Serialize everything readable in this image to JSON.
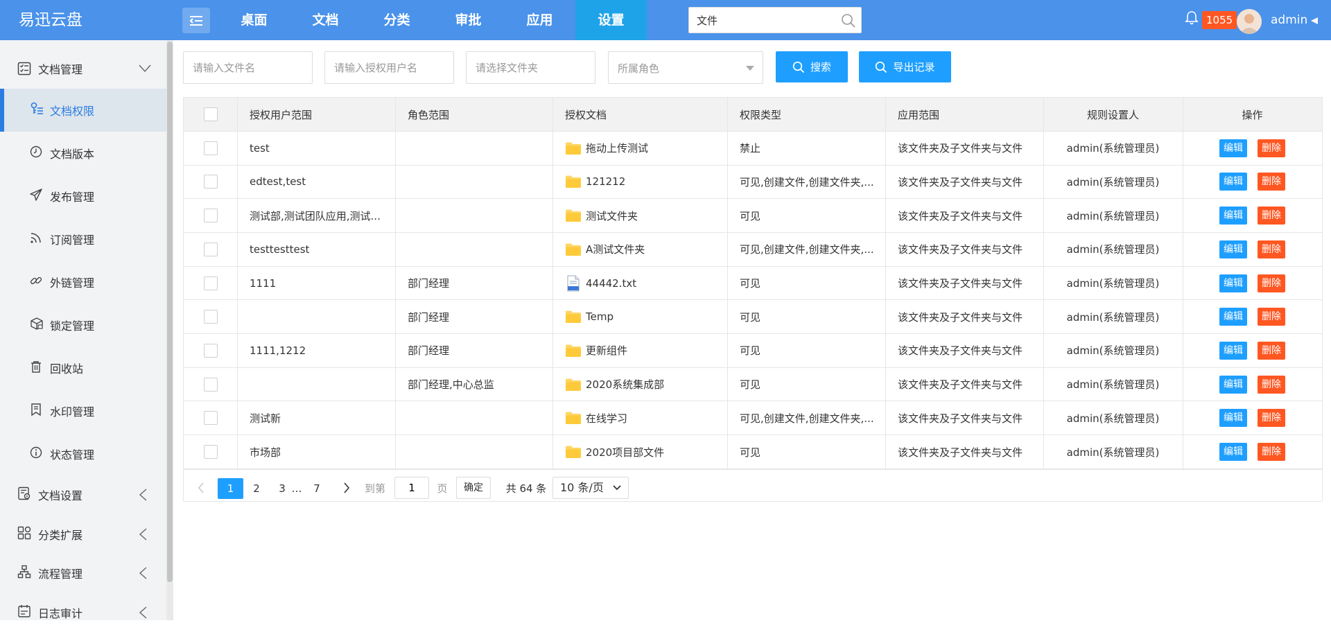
{
  "app": {
    "brand": "易迅云盘"
  },
  "nav": {
    "items": [
      "桌面",
      "文档",
      "分类",
      "审批",
      "应用",
      "设置"
    ],
    "active_index": 5
  },
  "top_search": {
    "value": "文件"
  },
  "user": {
    "notification_count": "1055",
    "name": "admin"
  },
  "sidebar": {
    "group_main": "文档管理",
    "items": [
      {
        "label": "文档权限",
        "icon": "key-user-icon"
      },
      {
        "label": "文档版本",
        "icon": "clock-icon"
      },
      {
        "label": "发布管理",
        "icon": "send-icon"
      },
      {
        "label": "订阅管理",
        "icon": "rss-icon"
      },
      {
        "label": "外链管理",
        "icon": "link-icon"
      },
      {
        "label": "锁定管理",
        "icon": "lock-box-icon"
      },
      {
        "label": "回收站",
        "icon": "trash-icon"
      },
      {
        "label": "水印管理",
        "icon": "watermark-icon"
      },
      {
        "label": "状态管理",
        "icon": "info-icon"
      }
    ],
    "active_item": 0,
    "groups": [
      {
        "label": "文档设置",
        "icon": "doc-settings-icon"
      },
      {
        "label": "分类扩展",
        "icon": "grid-icon"
      },
      {
        "label": "流程管理",
        "icon": "flow-icon"
      },
      {
        "label": "日志审计",
        "icon": "log-icon"
      }
    ]
  },
  "filters": {
    "filename_placeholder": "请输入文件名",
    "username_placeholder": "请输入授权用户名",
    "folder_placeholder": "请选择文件夹",
    "role_placeholder": "所属角色",
    "search_label": "搜索",
    "export_label": "导出记录"
  },
  "table": {
    "headers": [
      "授权用户范围",
      "角色范围",
      "授权文档",
      "权限类型",
      "应用范围",
      "规则设置人",
      "操作"
    ],
    "edit_label": "编辑",
    "delete_label": "删除",
    "rows": [
      {
        "users": "test",
        "roles": "",
        "doc": "拖动上传测试",
        "doc_type": "folder",
        "perm": "禁止",
        "scope": "该文件夹及子文件夹与文件",
        "setter": "admin(系统管理员)"
      },
      {
        "users": "edtest,test",
        "roles": "",
        "doc": "121212",
        "doc_type": "folder",
        "perm": "可见,创建文件,创建文件夹,...",
        "scope": "该文件夹及子文件夹与文件",
        "setter": "admin(系统管理员)"
      },
      {
        "users": "测试部,测试团队应用,测试...",
        "roles": "",
        "doc": "测试文件夹",
        "doc_type": "folder",
        "perm": "可见",
        "scope": "该文件夹及子文件夹与文件",
        "setter": "admin(系统管理员)"
      },
      {
        "users": "testtesttest",
        "roles": "",
        "doc": "A测试文件夹",
        "doc_type": "folder",
        "perm": "可见,创建文件,创建文件夹,...",
        "scope": "该文件夹及子文件夹与文件",
        "setter": "admin(系统管理员)"
      },
      {
        "users": "1111",
        "roles": "部门经理",
        "doc": "44442.txt",
        "doc_type": "txt",
        "perm": "可见",
        "scope": "该文件夹及子文件夹与文件",
        "setter": "admin(系统管理员)"
      },
      {
        "users": "",
        "roles": "部门经理",
        "doc": "Temp",
        "doc_type": "folder",
        "perm": "可见",
        "scope": "该文件夹及子文件夹与文件",
        "setter": "admin(系统管理员)"
      },
      {
        "users": "1111,1212",
        "roles": "部门经理",
        "doc": "更新组件",
        "doc_type": "folder",
        "perm": "可见",
        "scope": "该文件夹及子文件夹与文件",
        "setter": "admin(系统管理员)"
      },
      {
        "users": "",
        "roles": "部门经理,中心总监",
        "doc": "2020系统集成部",
        "doc_type": "folder",
        "perm": "可见",
        "scope": "该文件夹及子文件夹与文件",
        "setter": "admin(系统管理员)"
      },
      {
        "users": "测试新",
        "roles": "",
        "doc": "在线学习",
        "doc_type": "folder",
        "perm": "可见,创建文件,创建文件夹,...",
        "scope": "该文件夹及子文件夹与文件",
        "setter": "admin(系统管理员)"
      },
      {
        "users": "市场部",
        "roles": "",
        "doc": "2020项目部文件",
        "doc_type": "folder",
        "perm": "可见",
        "scope": "该文件夹及子文件夹与文件",
        "setter": "admin(系统管理员)"
      }
    ]
  },
  "pager": {
    "pages": [
      "1",
      "2",
      "3"
    ],
    "ellipsis": "…",
    "last_page": "7",
    "current": "1",
    "goto_prefix": "到第",
    "goto_value": "1",
    "goto_suffix": "页",
    "confirm_label": "确定",
    "total_text": "共 64 条",
    "page_size": "10 条/页"
  },
  "colors": {
    "topbar": "#4a92ea",
    "nav_active": "#1fa3e8",
    "primary": "#1e9fff",
    "danger": "#ff5722",
    "sidebar_active": "#2a7de1"
  }
}
